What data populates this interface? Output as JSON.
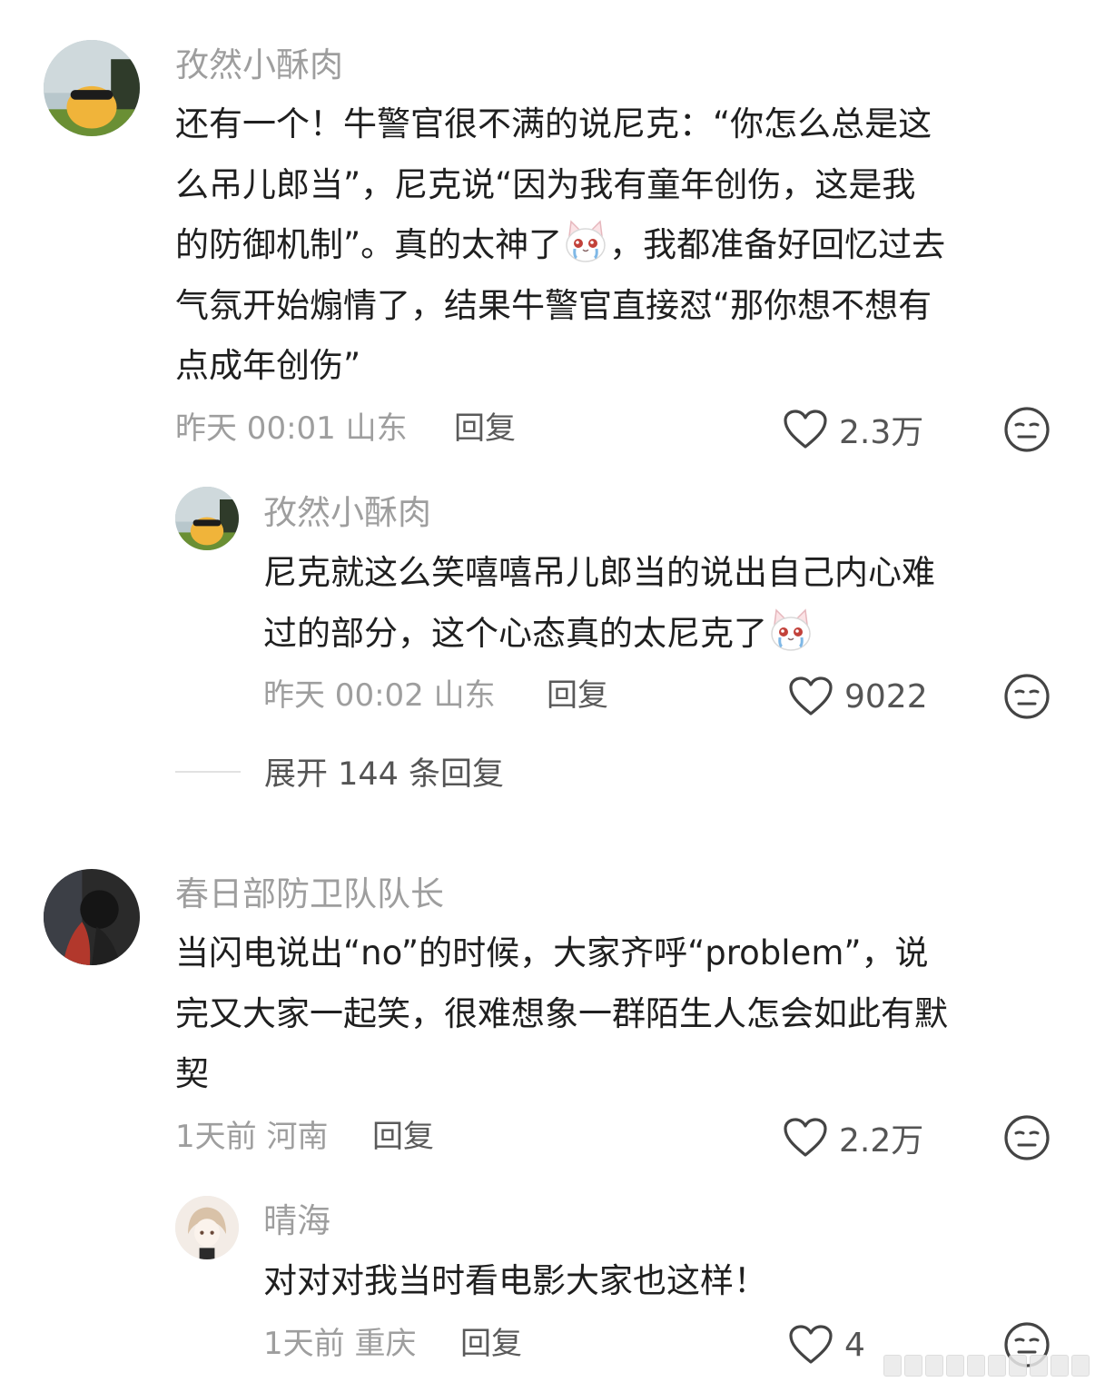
{
  "comments": [
    {
      "username": "孜然小酥肉",
      "lines": [
        "还有一个！牛警官很不满的说尼克：“你怎么总是这",
        "么吊儿郎当”，尼克说“因为我有童年创伤，这是我",
        "的防御机制”。真的太神了",
        "气氛开始煽情了，结果牛警官直接怼“那你想不想有",
        "点成年创伤”"
      ],
      "line3_after_emoji": "，我都准备好回忆过去",
      "time_location": "昨天 00:01 山东",
      "reply_label": "回复",
      "likes": "2.3万",
      "reply": {
        "username": "孜然小酥肉",
        "lines": [
          "尼克就这么笑嘻嘻吊儿郎当的说出自己内心难",
          "过的部分，这个心态真的太尼克了"
        ],
        "time_location": "昨天 00:02 山东",
        "reply_label": "回复",
        "likes": "9022"
      },
      "expand_label": "展开 144 条回复"
    },
    {
      "username": "春日部防卫队队长",
      "lines": [
        "当闪电说出“no”的时候，大家齐呼“problem”，说",
        "完又大家一起笑，很难想象一群陌生人怎会如此有默",
        "契"
      ],
      "time_location": "1天前 河南",
      "reply_label": "回复",
      "likes": "2.2万",
      "reply": {
        "username": "晴海",
        "lines": [
          "对对对我当时看电影大家也这样！"
        ],
        "time_location": "1天前 重庆",
        "reply_label": "回复",
        "likes": "4"
      }
    }
  ],
  "icons": {
    "like": "heart-outline-icon",
    "emoji_reaction": "neutral-face-icon",
    "inline_emoji": "crying-cat-emoji"
  }
}
